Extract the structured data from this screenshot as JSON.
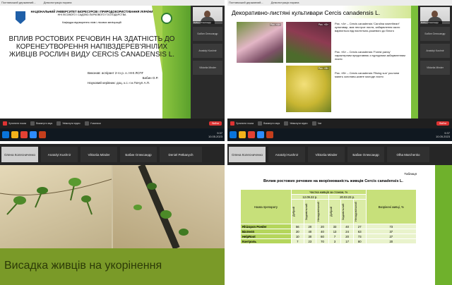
{
  "q1": {
    "topbar": [
      "Полтавський державний...",
      "Демонстрація екрана"
    ],
    "university": "НАЦІОНАЛЬНИЙ УНІВЕРСИТЕТ БІОРЕСУРСІВ І ПРИРОДОКОРИСТУВАННЯ УКРАЇНИ",
    "institute": "ННІ ЛІСОВОГО І САДОВО-ПАРКОВОГО ГОСПОДАРСТВА",
    "department": "Кафедра відтворення лісів і лісових меліорацій",
    "title": "ВПЛИВ РОСТОВИХ РЕЧОВИН НА ЗДАТНІСТЬ ДО КОРЕНЕУТВОРЕННЯ НАПІВЗДЕРЕВ'ЯНІЛИХ ЖИВЦІВ РОСЛИН ВИДУ CERCIS CANADENSIS L.",
    "performer": "Виконав: аспірант 2-го р. н. ННІ ЛСПГ",
    "performer_name": "Бабин О.Р.",
    "supervisor": "Науковий керівник: доц. к.с.-г.н.Почуп А.П.",
    "tiles": [
      "Бабин Олександр",
      "Anatolyi Kushnir",
      "Viktoriia Minder"
    ]
  },
  "q2": {
    "title": "Декоративно-листяні культивари Cercis canadensis L.",
    "photo_labels": [
      "Рис. «А»",
      "Рис. «Б»",
      "Рис. «В»"
    ],
    "caption_a": "Рис. «А» – Cercis canadensis 'Carolina sweetheart' культивар, має пестрое листя, забарвлення якого варіюється від пастельно-рожевого до білого",
    "caption_b": "Рис. «Б» – Cercis canadensis 'Forest pansy' характерним представник з пурпурним забарвленням листя",
    "caption_c": "Рис. «В» – Cercis canadensis 'Rising sun' рослини мають золотаво-жовте молоде листя",
    "tiles": [
      "Бабин Олександр",
      "Anatolyi Kushnir",
      "Viktoriia Minder"
    ]
  },
  "q3": {
    "participants": [
      "Олена Колесниченко",
      "Anatolyi Kushnir",
      "Viktoriia Minder",
      "Бабин Олександр",
      "Deniel Petkanych"
    ],
    "band_title": "Висадка живців на укорінення"
  },
  "q4": {
    "participants": [
      "Олена Колесниченко",
      "Anatolyi Kushnir",
      "Viktoriia Minder",
      "Бабин Олександр",
      "Olha Marchenko"
    ],
    "table_label": "Таблиця",
    "heading": "Вплив ростових речовин на вкорінюваність живців Cercis canadensis L.",
    "col_name": "Назва препарату",
    "col_share": "Частка живців за станом, %",
    "date1": "12.09.22 р.",
    "date2": "20.03.23 р.",
    "col_rooted": "Вкорінені живці, %",
    "sub": [
      "Добрий",
      "Задовільний",
      "Незадовільний",
      "Добрий",
      "Задовільний",
      "Незадовільний"
    ],
    "rows": [
      {
        "name": "Rhizopon Poeder",
        "v": [
          "56",
          "20",
          "20",
          "33",
          "40",
          "27"
        ],
        "rooted": "73"
      },
      {
        "name": "БіоХелп",
        "v": [
          "20",
          "40",
          "40",
          "13",
          "24",
          "63"
        ],
        "rooted": "37"
      },
      {
        "name": "HelpRoot",
        "v": [
          "10",
          "30",
          "60",
          "7",
          "20",
          "73"
        ],
        "rooted": "27"
      },
      {
        "name": "Контроль",
        "v": [
          "7",
          "23",
          "70",
          "3",
          "17",
          "80"
        ],
        "rooted": "20"
      }
    ]
  },
  "toolbar": {
    "share": "Зупинити показ",
    "items": [
      "Вимкнути звук",
      "Увімкнути відео",
      "Учасники",
      "Чат",
      "Реакції"
    ],
    "leave": "Вийти",
    "time": "9:37",
    "date": "10.05.2023"
  }
}
